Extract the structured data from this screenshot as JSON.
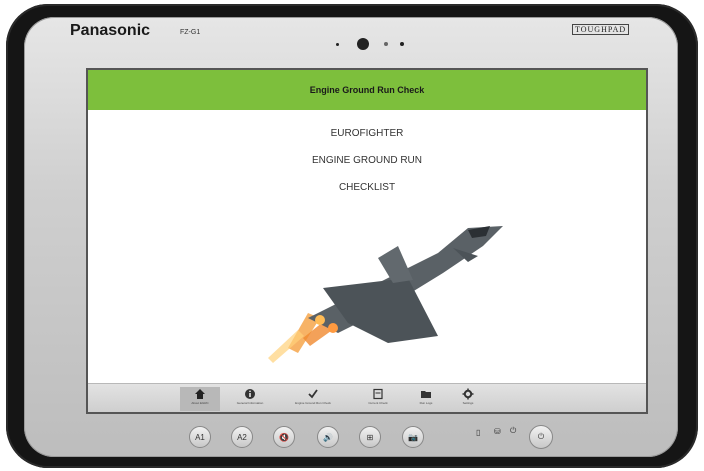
{
  "device": {
    "brand": "Panasonic",
    "model": "FZ-G1",
    "badge": "TOUGHPAD"
  },
  "app": {
    "title": "Engine Ground Run Check",
    "lines": [
      "EUROFIGHTER",
      "ENGINE GROUND RUN",
      "CHECKLIST"
    ],
    "accent": "#7dbf3c"
  },
  "nav": {
    "items": [
      {
        "icon": "home-icon",
        "label": "About EGRC"
      },
      {
        "icon": "info-icon",
        "label": "General Information"
      },
      {
        "icon": "checkmark-icon",
        "label": "Engine Ground Run Check"
      },
      {
        "icon": "clipboard-icon",
        "label": "Current Check"
      },
      {
        "icon": "folder-icon",
        "label": "Run Logs"
      },
      {
        "icon": "gear-icon",
        "label": "Settings"
      }
    ]
  },
  "hardware": {
    "buttons": [
      "A1",
      "A2",
      "🔇",
      "🔊",
      "⊞",
      "📷",
      "⏻"
    ]
  }
}
